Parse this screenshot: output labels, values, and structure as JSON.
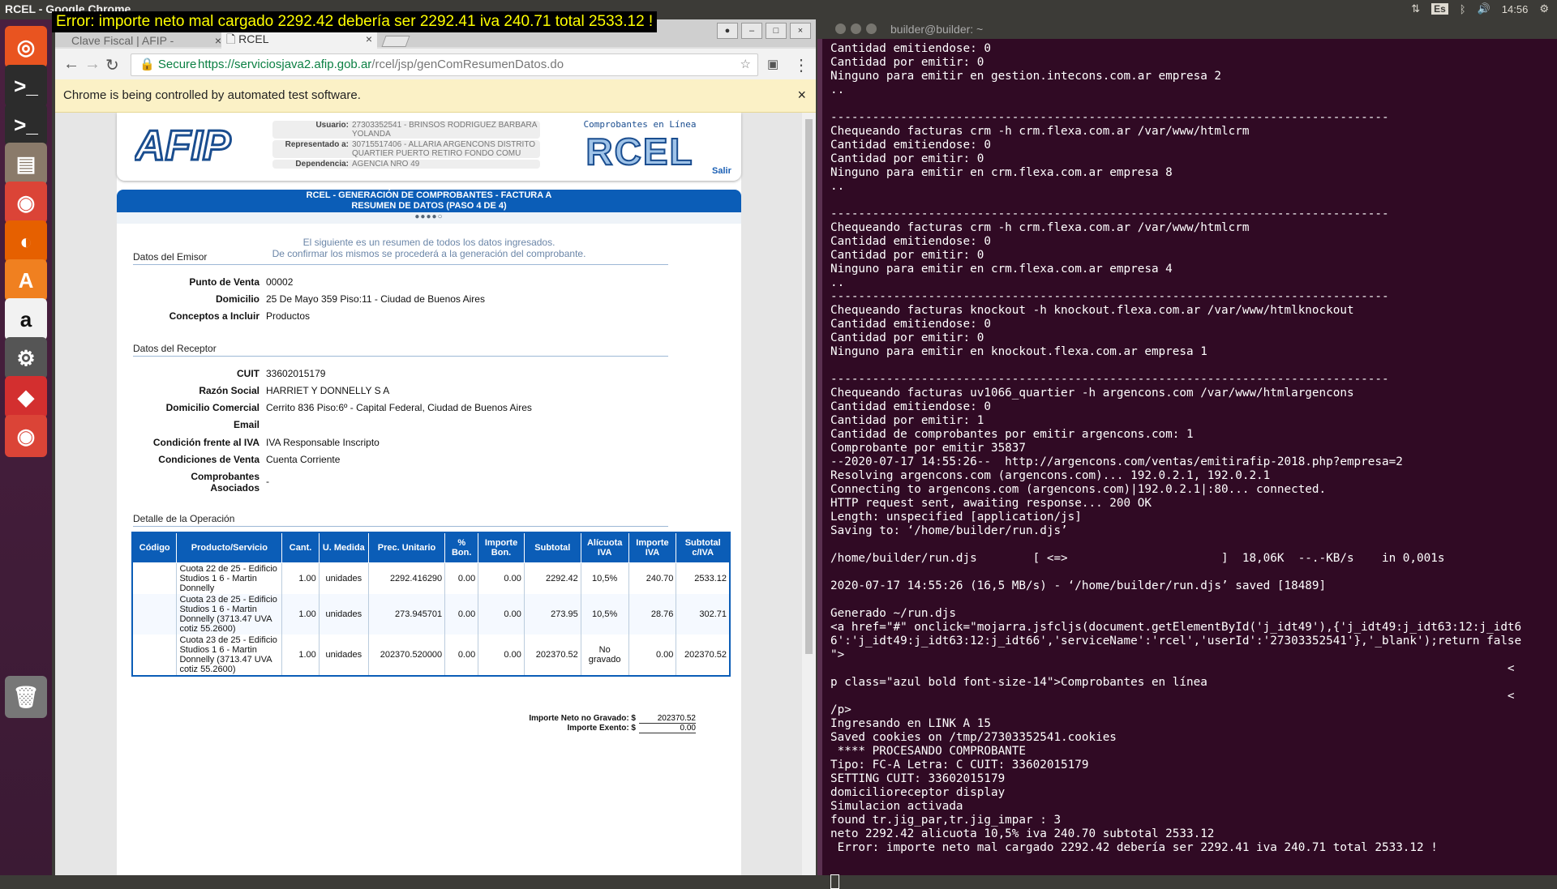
{
  "topbar": {
    "app_title": "RCEL - Google Chrome",
    "error_banner": "Error: importe neto mal cargado 2292.42 debería ser 2292.41 iva 240.71 total 2533.12 !",
    "keyboard_layout": "Es",
    "clock": "14:56"
  },
  "launcher": {
    "items": [
      {
        "name": "ubuntu-dash-icon",
        "glyph": "◎",
        "color": "#e95420"
      },
      {
        "name": "terminal-icon",
        "glyph": ">_",
        "color": "#2c2c2c"
      },
      {
        "name": "terminal-icon-2",
        "glyph": ">_",
        "color": "#2c2c2c"
      },
      {
        "name": "files-icon",
        "glyph": "▤",
        "color": "#8a7a6a"
      },
      {
        "name": "chrome-icon",
        "glyph": "◉",
        "color": "#db4437"
      },
      {
        "name": "firefox-icon",
        "glyph": "◐",
        "color": "#e66000"
      },
      {
        "name": "software-center-icon",
        "glyph": "A",
        "color": "#f08020"
      },
      {
        "name": "amazon-icon",
        "glyph": "a",
        "color": "#f2f2f2"
      },
      {
        "name": "settings-icon",
        "glyph": "⚙",
        "color": "#555"
      },
      {
        "name": "anydesk-icon",
        "glyph": "◆",
        "color": "#d32f2f"
      },
      {
        "name": "chrome-active-icon",
        "glyph": "◉",
        "color": "#db4437"
      },
      {
        "name": "trash-icon",
        "glyph": "🗑",
        "color": "#777"
      }
    ]
  },
  "browser": {
    "tabs": [
      {
        "label": "Clave Fiscal | AFIP -",
        "close": "×"
      },
      {
        "label": "RCEL",
        "close": "×"
      }
    ],
    "win_controls": [
      "–",
      "□",
      "×"
    ],
    "secure_label": "Secure",
    "url_host": "https://serviciosjava2.afip.gob.ar",
    "url_path": "/rcel/jsp/genComResumenDatos.do",
    "automation_notice": "Chrome is being controlled by automated test software.",
    "automation_close": "×"
  },
  "afip": {
    "logo_text": "AFIP",
    "user_rows": [
      {
        "key": "Usuario:",
        "value": "27303352541 - BRINSOS RODRIGUEZ BARBARA YOLANDA"
      },
      {
        "key": "Representado a:",
        "value": "30715517406 - ALLARIA ARGENCONS DISTRITO QUARTIER PUERTO RETIRO FONDO COMU"
      },
      {
        "key": "Dependencia:",
        "value": "AGENCIA NRO 49"
      }
    ],
    "rcel_sub": "Comprobantes en Línea",
    "rcel_logo": "RCEL",
    "salir": "Salir",
    "band_line1": "RCEL - GENERACIÓN DE COMPROBANTES - FACTURA A",
    "band_line2": "RESUMEN DE DATOS (PASO 4 DE 4)",
    "steps": "●●●●○",
    "intro_line1": "El siguiente es un resumen de todos los datos ingresados.",
    "intro_line2": "De confirmar los mismos se procederá a la generación del comprobante."
  },
  "emisor": {
    "title": "Datos del Emisor",
    "rows": [
      {
        "key": "Punto de Venta",
        "value": "00002"
      },
      {
        "key": "Domicilio",
        "value": "25 De Mayo 359 Piso:11 - Ciudad de Buenos Aires"
      },
      {
        "key": "Conceptos a Incluir",
        "value": "Productos"
      }
    ]
  },
  "receptor": {
    "title": "Datos del Receptor",
    "rows": [
      {
        "key": "CUIT",
        "value": "33602015179"
      },
      {
        "key": "Razón Social",
        "value": "HARRIET Y DONNELLY S A"
      },
      {
        "key": "Domicilio Comercial",
        "value": "Cerrito 836 Piso:6º - Capital Federal, Ciudad de Buenos Aires"
      },
      {
        "key": "Email",
        "value": ""
      },
      {
        "key": "Condición frente al IVA",
        "value": "IVA Responsable Inscripto"
      },
      {
        "key": "Condiciones de Venta",
        "value": "Cuenta Corriente"
      },
      {
        "key": "Comprobantes Asociados",
        "value": "-"
      }
    ]
  },
  "operacion": {
    "title": "Detalle de la Operación",
    "headers": [
      "Código",
      "Producto/Servicio",
      "Cant.",
      "U. Medida",
      "Prec. Unitario",
      "% Bon.",
      "Importe Bon.",
      "Subtotal",
      "Alícuota IVA",
      "Importe IVA",
      "Subtotal c/IVA"
    ],
    "rows": [
      [
        "",
        "Cuota 22 de 25 - Edificio Studios 1 6 - Martin Donnelly",
        "1.00",
        "unidades",
        "2292.416290",
        "0.00",
        "0.00",
        "2292.42",
        "10,5%",
        "240.70",
        "2533.12"
      ],
      [
        "",
        "Cuota 23 de 25 - Edificio Studios 1 6 - Martin Donnelly (3713.47 UVA cotiz 55.2600)",
        "1.00",
        "unidades",
        "273.945701",
        "0.00",
        "0.00",
        "273.95",
        "10,5%",
        "28.76",
        "302.71"
      ],
      [
        "",
        "Cuota 23 de 25 - Edificio Studios 1 6 - Martin Donnelly (3713.47 UVA cotiz 55.2600)",
        "1.00",
        "unidades",
        "202370.520000",
        "0.00",
        "0.00",
        "202370.52",
        "No gravado",
        "0.00",
        "202370.52"
      ]
    ],
    "totals": [
      {
        "key": "Importe Neto no Gravado: $",
        "value": "202370.52"
      },
      {
        "key": "Importe Exento: $",
        "value": "0.00"
      }
    ]
  },
  "terminal": {
    "title": "builder@builder: ~",
    "lines": [
      "Cantidad emitiendose: 0",
      "Cantidad por emitir: 0",
      "Ninguno para emitir en gestion.intecons.com.ar empresa 2",
      "..",
      "",
      "--------------------------------------------------------------------------------",
      "Chequeando facturas crm -h crm.flexa.com.ar /var/www/htmlcrm",
      "Cantidad emitiendose: 0",
      "Cantidad por emitir: 0",
      "Ninguno para emitir en crm.flexa.com.ar empresa 8",
      "..",
      "",
      "--------------------------------------------------------------------------------",
      "Chequeando facturas crm -h crm.flexa.com.ar /var/www/htmlcrm",
      "Cantidad emitiendose: 0",
      "Cantidad por emitir: 0",
      "Ninguno para emitir en crm.flexa.com.ar empresa 4",
      "..",
      "--------------------------------------------------------------------------------",
      "Chequeando facturas knockout -h knockout.flexa.com.ar /var/www/htmlknockout",
      "Cantidad emitiendose: 0",
      "Cantidad por emitir: 0",
      "Ninguno para emitir en knockout.flexa.com.ar empresa 1",
      "",
      "--------------------------------------------------------------------------------",
      "Chequeando facturas uv1066_quartier -h argencons.com /var/www/htmlargencons",
      "Cantidad emitiendose: 0",
      "Cantidad por emitir: 1",
      "Cantidad de comprobantes por emitir argencons.com: 1",
      "Comprobante por emitir 35837",
      "--2020-07-17 14:55:26--  http://argencons.com/ventas/emitirafip-2018.php?empresa=2",
      "Resolving argencons.com (argencons.com)... 192.0.2.1, 192.0.2.1",
      "Connecting to argencons.com (argencons.com)|192.0.2.1|:80... connected.",
      "HTTP request sent, awaiting response... 200 OK",
      "Length: unspecified [application/js]",
      "Saving to: ‘/home/builder/run.djs’",
      "",
      "/home/builder/run.djs        [ <=>                      ]  18,06K  --.-KB/s    in 0,001s",
      "",
      "2020-07-17 14:55:26 (16,5 MB/s) - ‘/home/builder/run.djs’ saved [18489]",
      "",
      "Generado ~/run.djs",
      "<a href=\"#\" onclick=\"mojarra.jsfcljs(document.getElementById('j_idt49'),{'j_idt49:j_idt63:12:j_idt6",
      "6':'j_idt49:j_idt63:12:j_idt66','serviceName':'rcel','userId':'27303352541'},'_blank');return false",
      "\">",
      "                                                                                                 <",
      "p class=\"azul bold font-size-14\">Comprobantes en línea",
      "                                                                                                 <",
      "/p>",
      "Ingresando en LINK A 15",
      "Saved cookies on /tmp/27303352541.cookies",
      " **** PROCESANDO COMPROBANTE",
      "Tipo: FC-A Letra: C CUIT: 33602015179",
      "SETTING CUIT: 33602015179",
      "domicilioreceptor display",
      "Simulacion activada",
      "found tr.jig_par,tr.jig_impar : 3",
      "neto 2292.42 alicuota 10,5% iva 240.70 subtotal 2533.12",
      " Error: importe neto mal cargado 2292.42 debería ser 2292.41 iva 240.71 total 2533.12 !"
    ]
  }
}
